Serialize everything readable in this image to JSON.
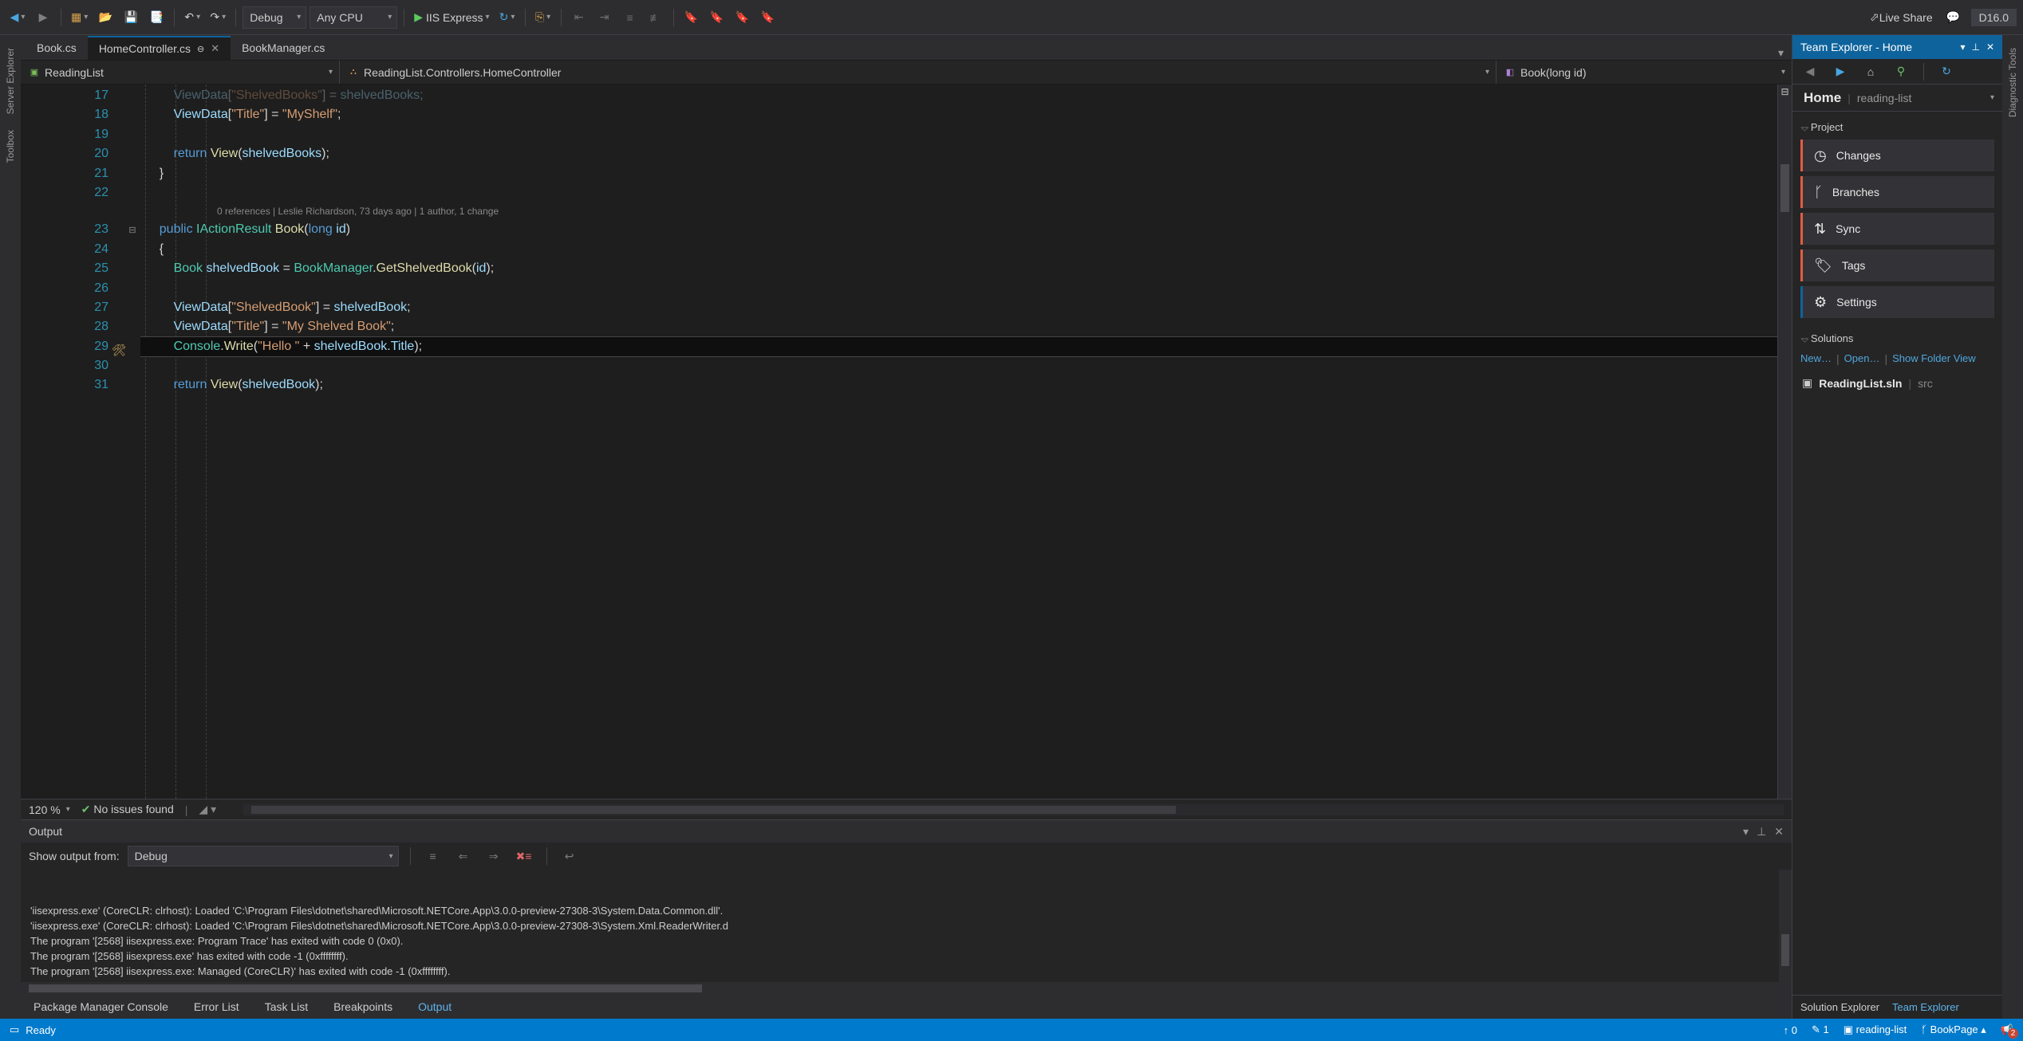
{
  "toolbar": {
    "config": "Debug",
    "platform": "Any CPU",
    "run_target": "IIS Express",
    "live_share": "Live Share",
    "version": "D16.0"
  },
  "side_tabs_left": [
    "Server Explorer",
    "Toolbox"
  ],
  "side_tabs_right": [
    "Diagnostic Tools"
  ],
  "editor_tabs": [
    {
      "label": "Book.cs",
      "active": false
    },
    {
      "label": "HomeController.cs",
      "active": true,
      "pinned": true
    },
    {
      "label": "BookManager.cs",
      "active": false
    }
  ],
  "nav": {
    "project": "ReadingList",
    "type": "ReadingList.Controllers.HomeController",
    "member": "Book(long id)"
  },
  "codelens": "0 references | Leslie Richardson, 73 days ago | 1 author, 1 change",
  "code_lines": [
    {
      "n": 17,
      "html": "        <span class='tk-id'>ViewData</span><span class='tk-pn'>[</span><span class='tk-str'>\"ShelvedBooks\"</span><span class='tk-pn'>] = </span><span class='tk-id'>shelvedBooks</span><span class='tk-pn'>;</span>",
      "fade": true
    },
    {
      "n": 18,
      "html": "        <span class='tk-id'>ViewData</span><span class='tk-pn'>[</span><span class='tk-str'>\"Title\"</span><span class='tk-pn'>] = </span><span class='tk-str'>\"MyShelf\"</span><span class='tk-pn'>;</span>"
    },
    {
      "n": 19,
      "html": ""
    },
    {
      "n": 20,
      "html": "        <span class='tk-kw'>return</span> <span class='tk-mtd'>View</span><span class='tk-pn'>(</span><span class='tk-id'>shelvedBooks</span><span class='tk-pn'>);</span>"
    },
    {
      "n": 21,
      "html": "    <span class='tk-pn'>}</span>"
    },
    {
      "n": 22,
      "html": ""
    },
    {
      "n": 23,
      "html": "    <span class='tk-kw'>public</span> <span class='tk-type'>IActionResult</span> <span class='tk-mtd'>Book</span><span class='tk-pn'>(</span><span class='tk-kw'>long</span> <span class='tk-id'>id</span><span class='tk-pn'>)</span>",
      "fold": true,
      "codelens": true
    },
    {
      "n": 24,
      "html": "    <span class='tk-pn'>{</span>"
    },
    {
      "n": 25,
      "html": "        <span class='tk-type'>Book</span> <span class='tk-id'>shelvedBook</span> <span class='tk-pn'>=</span> <span class='tk-type'>BookManager</span><span class='tk-pn'>.</span><span class='tk-mtd'>GetShelvedBook</span><span class='tk-pn'>(</span><span class='tk-id'>id</span><span class='tk-pn'>);</span>"
    },
    {
      "n": 26,
      "html": ""
    },
    {
      "n": 27,
      "html": "        <span class='tk-id'>ViewData</span><span class='tk-pn'>[</span><span class='tk-str'>\"ShelvedBook\"</span><span class='tk-pn'>] = </span><span class='tk-id'>shelvedBook</span><span class='tk-pn'>;</span>"
    },
    {
      "n": 28,
      "html": "        <span class='tk-id'>ViewData</span><span class='tk-pn'>[</span><span class='tk-str'>\"Title\"</span><span class='tk-pn'>] = </span><span class='tk-str'>\"My Shelved Book\"</span><span class='tk-pn'>;</span>"
    },
    {
      "n": 29,
      "html": "        <span class='tk-type'>Console</span><span class='tk-pn'>.</span><span class='tk-mtd'>Write</span><span class='tk-pn'>(</span><span class='tk-str'>\"Hello \"</span> <span class='tk-pn'>+</span> <span class='tk-id'>shelvedBook</span><span class='tk-pn'>.</span><span class='tk-id'>Title</span><span class='tk-pn'>);</span>",
      "current": true,
      "screwdriver": true
    },
    {
      "n": 30,
      "html": ""
    },
    {
      "n": 31,
      "html": "        <span class='tk-kw'>return</span> <span class='tk-mtd'>View</span><span class='tk-pn'>(</span><span class='tk-id'>shelvedBook</span><span class='tk-pn'>);</span>"
    }
  ],
  "editor_footer": {
    "zoom": "120 %",
    "issues": "No issues found"
  },
  "output": {
    "title": "Output",
    "from_label": "Show output from:",
    "from_value": "Debug",
    "lines": [
      "'iisexpress.exe' (CoreCLR: clrhost): Loaded 'C:\\Program Files\\dotnet\\shared\\Microsoft.NETCore.App\\3.0.0-preview-27308-3\\System.Data.Common.dll'.",
      "'iisexpress.exe' (CoreCLR: clrhost): Loaded 'C:\\Program Files\\dotnet\\shared\\Microsoft.NETCore.App\\3.0.0-preview-27308-3\\System.Xml.ReaderWriter.d",
      "The program '[2568] iisexpress.exe: Program Trace' has exited with code 0 (0x0).",
      "The program '[2568] iisexpress.exe' has exited with code -1 (0xffffffff).",
      "The program '[2568] iisexpress.exe: Managed (CoreCLR)' has exited with code -1 (0xffffffff)."
    ]
  },
  "bottom_tabs": [
    "Package Manager Console",
    "Error List",
    "Task List",
    "Breakpoints",
    "Output"
  ],
  "bottom_tabs_active": "Output",
  "team_explorer": {
    "title": "Team Explorer - Home",
    "header_main": "Home",
    "header_sub": "reading-list",
    "project_section": "Project",
    "tiles": [
      {
        "icon": "clock",
        "label": "Changes"
      },
      {
        "icon": "branch",
        "label": "Branches"
      },
      {
        "icon": "sync",
        "label": "Sync"
      },
      {
        "icon": "tag",
        "label": "Tags"
      },
      {
        "icon": "gear",
        "label": "Settings",
        "blue": true
      }
    ],
    "solutions_section": "Solutions",
    "links": [
      "New…",
      "Open…",
      "Show Folder View"
    ],
    "sln_name": "ReadingList.sln",
    "sln_folder": "src",
    "bottom_tabs": [
      "Solution Explorer",
      "Team Explorer"
    ],
    "bottom_active": "Team Explorer"
  },
  "status": {
    "ready": "Ready",
    "publish_up": "0",
    "pencil": "1",
    "repo": "reading-list",
    "branch": "BookPage",
    "notif_count": "2"
  }
}
